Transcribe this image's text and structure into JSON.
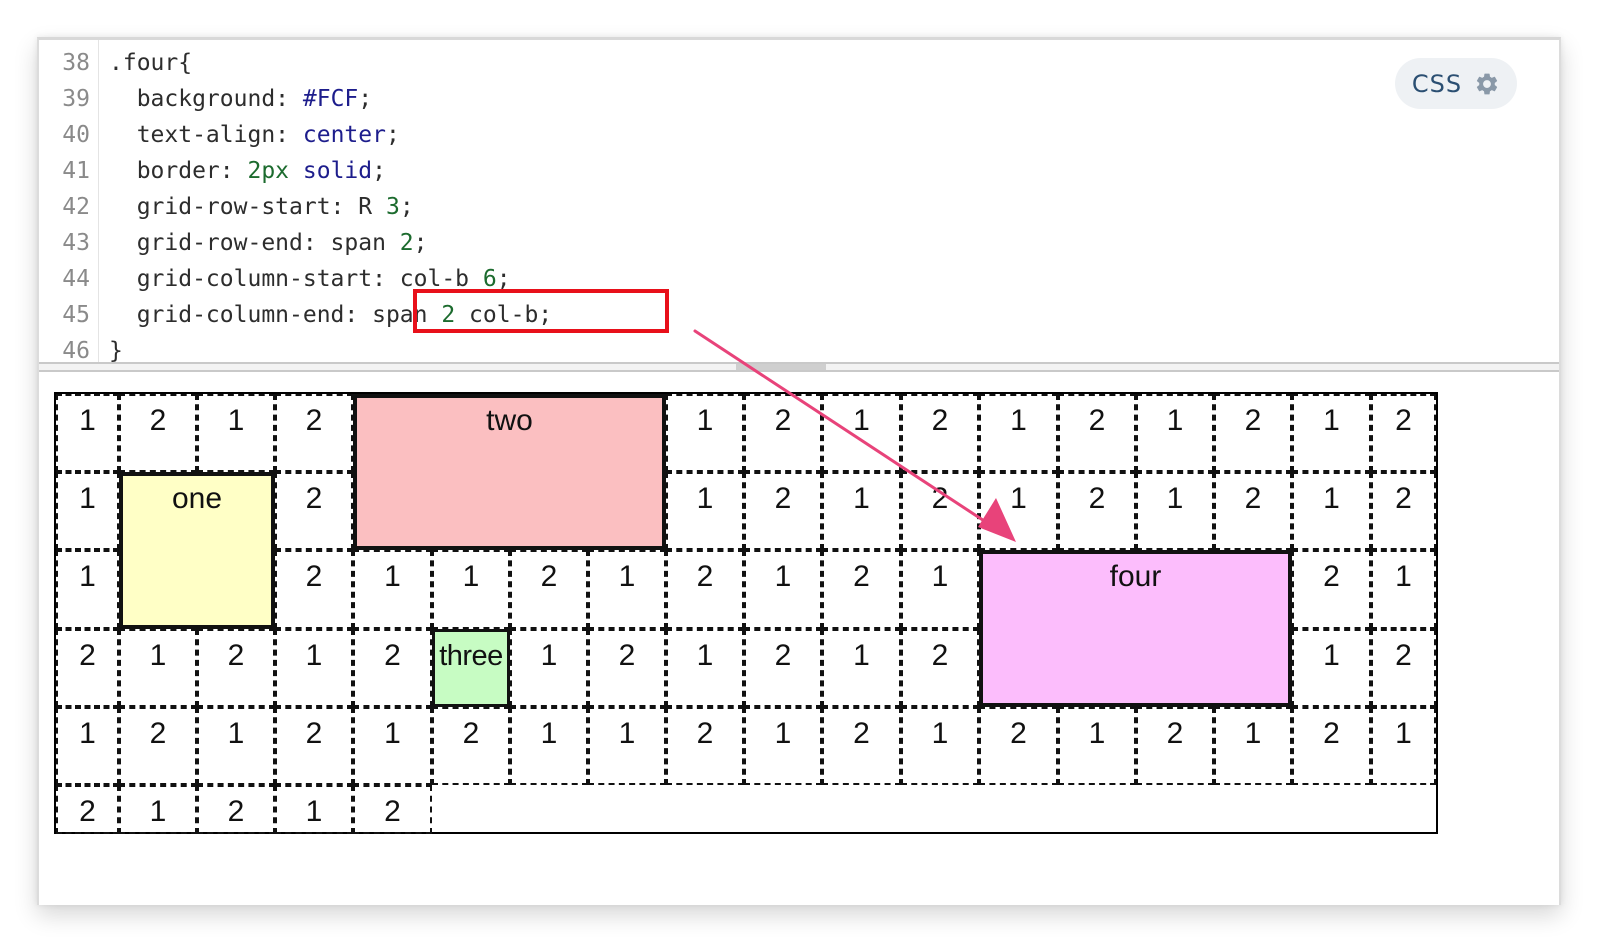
{
  "editor": {
    "language_label": "CSS",
    "language_icon": "gear-icon",
    "lines": [
      {
        "number": "38",
        "tokens": [
          {
            "t": ".four{",
            "c": "plain"
          }
        ]
      },
      {
        "number": "39",
        "tokens": [
          {
            "t": "  background: ",
            "c": "plain"
          },
          {
            "t": "#FCF",
            "c": "kw"
          },
          {
            "t": ";",
            "c": "plain"
          }
        ]
      },
      {
        "number": "40",
        "tokens": [
          {
            "t": "  text-align: ",
            "c": "plain"
          },
          {
            "t": "center",
            "c": "kw"
          },
          {
            "t": ";",
            "c": "plain"
          }
        ]
      },
      {
        "number": "41",
        "tokens": [
          {
            "t": "  border: ",
            "c": "plain"
          },
          {
            "t": "2px",
            "c": "num"
          },
          {
            "t": " ",
            "c": "plain"
          },
          {
            "t": "solid",
            "c": "kw"
          },
          {
            "t": ";",
            "c": "plain"
          }
        ]
      },
      {
        "number": "42",
        "tokens": [
          {
            "t": "  grid-row-start: R ",
            "c": "plain"
          },
          {
            "t": "3",
            "c": "num"
          },
          {
            "t": ";",
            "c": "plain"
          }
        ]
      },
      {
        "number": "43",
        "tokens": [
          {
            "t": "  grid-row-end: span ",
            "c": "plain"
          },
          {
            "t": "2",
            "c": "num"
          },
          {
            "t": ";",
            "c": "plain"
          }
        ]
      },
      {
        "number": "44",
        "tokens": [
          {
            "t": "  grid-column-start: col-b ",
            "c": "plain"
          },
          {
            "t": "6",
            "c": "num"
          },
          {
            "t": ";",
            "c": "plain"
          }
        ]
      },
      {
        "number": "45",
        "tokens": [
          {
            "t": "  grid-column-end: span ",
            "c": "plain"
          },
          {
            "t": "2",
            "c": "num"
          },
          {
            "t": " col-b;",
            "c": "plain"
          }
        ]
      },
      {
        "number": "46",
        "tokens": [
          {
            "t": "}",
            "c": "plain"
          }
        ]
      }
    ],
    "highlighted_code": "span 2 col-b;",
    "highlight_color": "#e8101a",
    "token_colors": {
      "plain": "#2d2d2d",
      "kw": "#1d1d8c",
      "num": "#1c6b2e"
    }
  },
  "preview": {
    "rows": [
      [
        "1",
        "2",
        "1",
        "2",
        "",
        "",
        "",
        "",
        "1",
        "2",
        "1",
        "2",
        "1",
        "2",
        "1",
        "2",
        "1",
        "2"
      ],
      [
        "1",
        "",
        "",
        "2",
        "",
        "",
        "",
        "",
        "1",
        "2",
        "1",
        "2",
        "1",
        "2",
        "1",
        "2",
        "1",
        "2"
      ],
      [
        "1",
        "",
        "",
        "2",
        "1",
        "1",
        "2",
        "1",
        "2",
        "1",
        "2",
        "1",
        "",
        "",
        "",
        "",
        "2",
        "1"
      ],
      [
        "2",
        "1",
        "2",
        "1",
        "2",
        "",
        "1",
        "2",
        "1",
        "2",
        "1",
        "2",
        "",
        "",
        "",
        "",
        "1",
        "2"
      ],
      [
        "1",
        "2",
        "1",
        "2",
        "1",
        "2",
        "1",
        "1",
        "2",
        "1",
        "2",
        "1",
        "2",
        "1",
        "2",
        "1",
        "2",
        "1"
      ],
      [
        "2",
        "1",
        "2",
        "1",
        "2"
      ]
    ],
    "items": [
      {
        "key": "one",
        "label": "one",
        "color": "#FFFFC6",
        "col": 1,
        "row": 1,
        "cspan": 2,
        "rspan": 2
      },
      {
        "key": "two",
        "label": "two",
        "color": "#FBBFC1",
        "col": 4,
        "row": 0,
        "cspan": 4,
        "rspan": 2
      },
      {
        "key": "three",
        "label": "three",
        "color": "#C7FCC3",
        "col": 5,
        "row": 3,
        "cspan": 1,
        "rspan": 1
      },
      {
        "key": "four",
        "label": "four",
        "color": "#FCBDFC",
        "col": 12,
        "row": 2,
        "cspan": 4,
        "rspan": 2
      }
    ]
  },
  "annotation": {
    "arrow_color": "#e8437a"
  }
}
